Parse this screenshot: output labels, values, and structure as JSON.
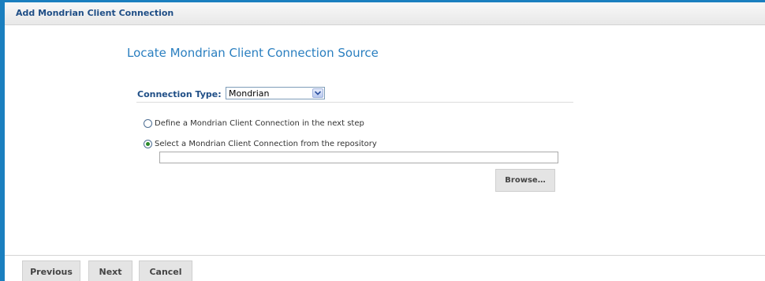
{
  "dialog": {
    "title": "Add Mondrian Client Connection"
  },
  "main": {
    "heading": "Locate Mondrian Client Connection Source",
    "connection_type": {
      "label": "Connection Type:",
      "selected": "Mondrian"
    },
    "options": [
      {
        "label": "Define a Mondrian Client Connection in the next step",
        "checked": false
      },
      {
        "label": "Select a Mondrian Client Connection from the repository",
        "checked": true
      }
    ],
    "repository_path": {
      "value": "",
      "placeholder": ""
    },
    "browse_label": "Browse…"
  },
  "footer": {
    "previous_label": "Previous",
    "next_label": "Next",
    "cancel_label": "Cancel"
  },
  "colors": {
    "accent_border": "#1a7fbf",
    "heading": "#2a7fc0",
    "title_text": "#1f4e86",
    "button_bg": "#e4e4e4"
  },
  "icons": {
    "select_arrow": "chevron-down-icon"
  }
}
